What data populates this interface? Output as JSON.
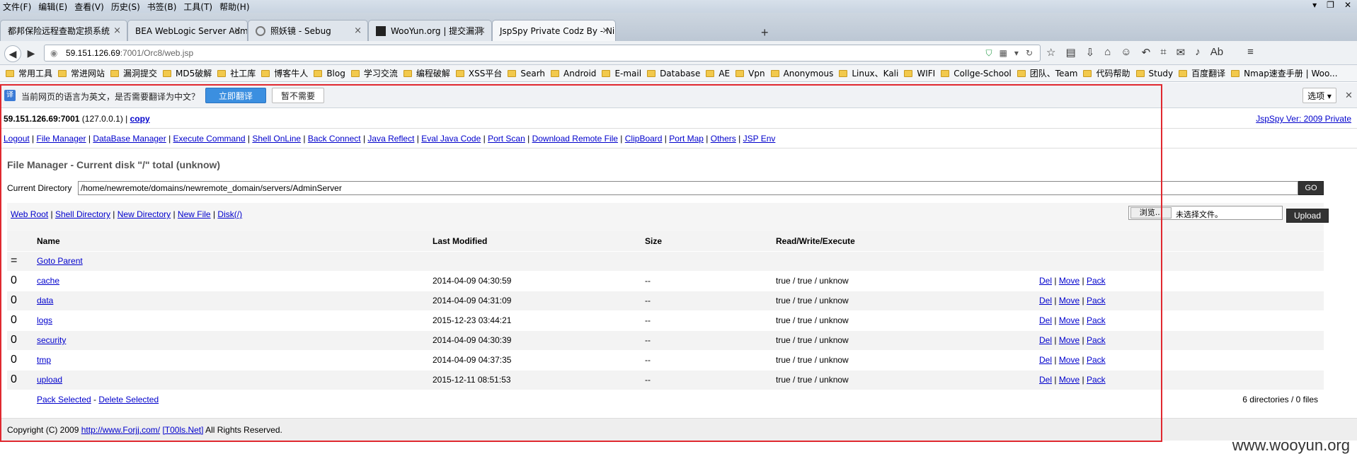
{
  "browser": {
    "menu": [
      "文件(F)",
      "编辑(E)",
      "查看(V)",
      "历史(S)",
      "书签(B)",
      "工具(T)",
      "帮助(H)"
    ],
    "tabs": [
      {
        "label": "都邦保险远程查勘定损系统",
        "active": false
      },
      {
        "label": "BEA WebLogic Server Administ...",
        "active": false
      },
      {
        "label": "照妖镜 - Sebug",
        "active": false
      },
      {
        "label": "WooYun.org | 提交漏洞",
        "active": false
      },
      {
        "label": "JspSpy Private Codz By - Ninty",
        "active": true
      }
    ],
    "url_host": "59.151.126.69",
    "url_path": ":7001/Orc8/web.jsp",
    "bookmarks": [
      "常用工具",
      "常进网站",
      "漏洞提交",
      "MD5破解",
      "社工库",
      "博客牛人",
      "Blog",
      "学习交流",
      "编程破解",
      "XSS平台",
      "Searh",
      "Android",
      "E-mail",
      "Database",
      "AE",
      "Vpn",
      "Anonymous",
      "Linux、Kali",
      "WIFI",
      "Collge-School",
      "团队、Team",
      "代码帮助",
      "Study",
      "百度翻译",
      "Nmap速查手册 | Woo..."
    ]
  },
  "translate_bar": {
    "message": "当前网页的语言为英文，是否需要翻译为中文？",
    "translate_label": "立即翻译",
    "no_label": "暂不需要",
    "options_label": "选项 ▾"
  },
  "jspspy": {
    "host": "59.151.126.69:7001",
    "local_ip": "(127.0.0.1)",
    "copy_label": "copy",
    "version_label": "JspSpy Ver: 2009 Private",
    "menu_links": [
      "Logout",
      "File Manager",
      "DataBase Manager",
      "Execute Command",
      "Shell OnLine",
      "Back Connect",
      "Java Reflect",
      "Eval Java Code",
      "Port Scan",
      "Download Remote File",
      "ClipBoard",
      "Port Map",
      "Others",
      "JSP Env"
    ],
    "fm_title": "File Manager - Current disk \"/\" total (unknow)",
    "current_dir_label": "Current Directory",
    "current_dir_value": "/home/newremote/domains/newremote_domain/servers/AdminServer",
    "go_label": "GO",
    "tool_links": [
      "Web Root",
      "Shell Directory",
      "New Directory",
      "New File",
      "Disk(/)"
    ],
    "browse_label": "浏览...",
    "no_file_label": "未选择文件。",
    "upload_label": "Upload",
    "columns": {
      "name": "Name",
      "modified": "Last Modified",
      "size": "Size",
      "rwx": "Read/Write/Execute"
    },
    "parent_icon": "=",
    "goto_parent": "Goto Parent",
    "files": [
      {
        "icon": "0",
        "name": "cache",
        "modified": "2014-04-09 04:30:59",
        "size": "--",
        "rwx": "true / true / unknow"
      },
      {
        "icon": "0",
        "name": "data",
        "modified": "2014-04-09 04:31:09",
        "size": "--",
        "rwx": "true / true / unknow"
      },
      {
        "icon": "0",
        "name": "logs",
        "modified": "2015-12-23 03:44:21",
        "size": "--",
        "rwx": "true / true / unknow"
      },
      {
        "icon": "0",
        "name": "security",
        "modified": "2014-04-09 04:30:39",
        "size": "--",
        "rwx": "true / true / unknow"
      },
      {
        "icon": "0",
        "name": "tmp",
        "modified": "2014-04-09 04:37:35",
        "size": "--",
        "rwx": "true / true / unknow"
      },
      {
        "icon": "0",
        "name": "upload",
        "modified": "2015-12-11 08:51:53",
        "size": "--",
        "rwx": "true / true / unknow"
      }
    ],
    "row_actions": [
      "Del",
      "Move",
      "Pack"
    ],
    "pack_selected": "Pack Selected",
    "delete_selected": "Delete Selected",
    "summary": "6 directories / 0 files",
    "copyright_prefix": "Copyright (C) 2009",
    "copyright_link1": "http://www.Forjj.com/",
    "copyright_link2": "[T00ls.Net]",
    "copyright_suffix": "All Rights Reserved."
  },
  "watermark": "www.wooyun.org"
}
